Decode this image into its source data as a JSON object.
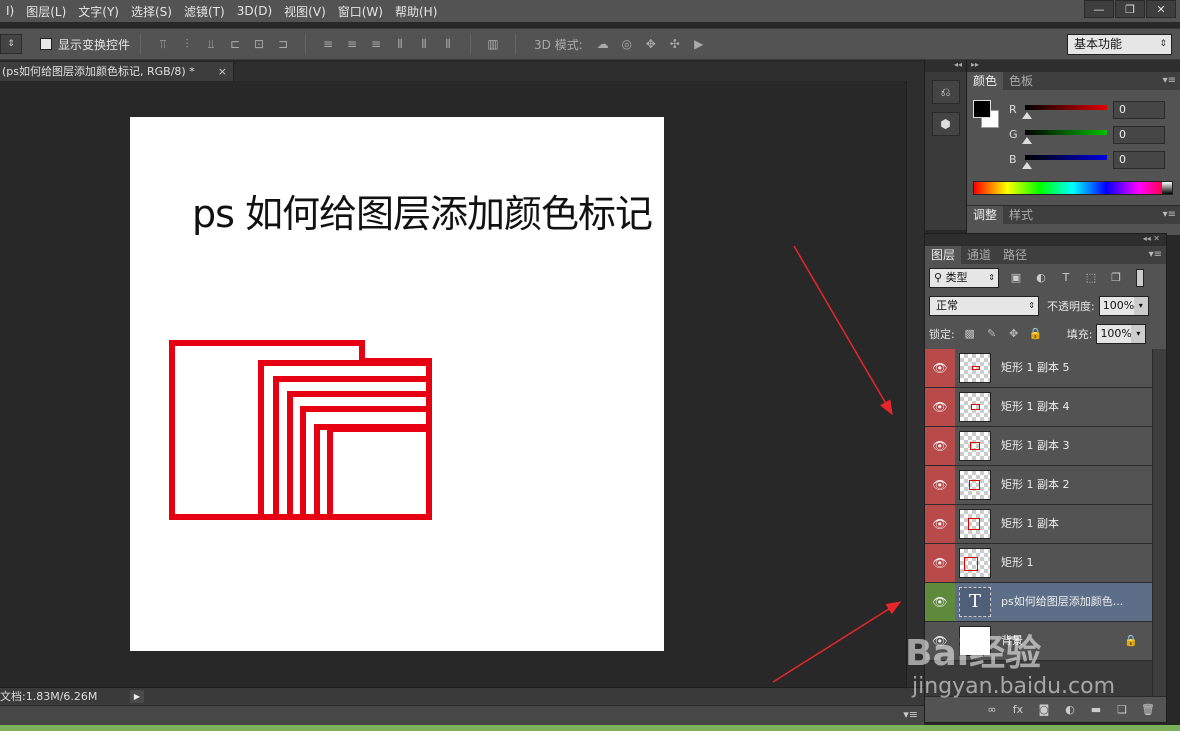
{
  "menu": {
    "items": [
      "I)",
      "图层(L)",
      "文字(Y)",
      "选择(S)",
      "滤镜(T)",
      "3D(D)",
      "视图(V)",
      "窗口(W)",
      "帮助(H)"
    ]
  },
  "window_buttons": [
    "—",
    "❐",
    "✕"
  ],
  "options_bar": {
    "show_transform_label": "显示变换控件",
    "mode_3d_label": "3D 模式:",
    "workspace_value": "基本功能"
  },
  "document_tab": {
    "title": "(ps如何给图层添加颜色标记, RGB/8) *",
    "close": "×"
  },
  "document": {
    "heading": "ps 如何给图层添加颜色标记",
    "shape_color": "#e60012"
  },
  "status": {
    "doc_size": "文档:1.83M/6.26M"
  },
  "color_panel": {
    "tabs": [
      "颜色",
      "色板"
    ],
    "channels": [
      {
        "label": "R",
        "value": "0",
        "color": "#e00000"
      },
      {
        "label": "G",
        "value": "0",
        "color": "#00c000"
      },
      {
        "label": "B",
        "value": "0",
        "color": "#0000e0"
      }
    ]
  },
  "adjust_panel": {
    "tabs": [
      "调整",
      "样式"
    ]
  },
  "layers_panel": {
    "tabs": [
      "图层",
      "通道",
      "路径"
    ],
    "filter_kind": "类型",
    "blend_mode": "正常",
    "opacity_label": "不透明度:",
    "opacity_value": "100%",
    "lock_label": "锁定:",
    "fill_label": "填充:",
    "fill_value": "100%",
    "layers": [
      {
        "name": "矩形 1 副本 5",
        "label_color": "#b94a4a"
      },
      {
        "name": "矩形 1 副本 4",
        "label_color": "#b94a4a"
      },
      {
        "name": "矩形 1 副本 3",
        "label_color": "#b94a4a"
      },
      {
        "name": "矩形 1 副本 2",
        "label_color": "#b94a4a"
      },
      {
        "name": "矩形 1 副本",
        "label_color": "#b94a4a"
      },
      {
        "name": "矩形 1",
        "label_color": "#b94a4a"
      },
      {
        "name": "ps如何给图层添加颜色...",
        "label_color": "#5f8a3c",
        "selected": true
      },
      {
        "name": "背景",
        "label_color": "none"
      }
    ]
  },
  "watermark": {
    "logo": "Bai经验",
    "url": "jingyan.baidu.com"
  }
}
